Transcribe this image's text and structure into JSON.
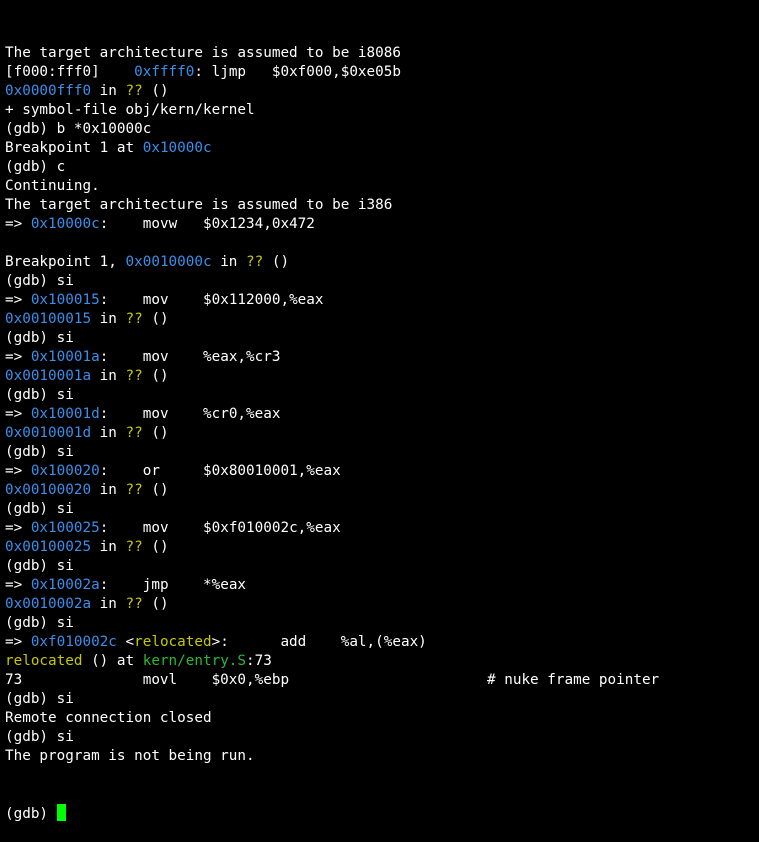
{
  "colors": {
    "background": "#000000",
    "text": "#ffffff",
    "address": "#3b8eea",
    "function": "#c8c800",
    "file": "#2fb82f",
    "cursor": "#00ff00"
  },
  "terminal": {
    "lines": [
      [
        {
          "t": "The target architecture is assumed to be i8086",
          "c": "text"
        }
      ],
      [
        {
          "t": "[f000:fff0]    ",
          "c": "text"
        },
        {
          "t": "0xffff0",
          "c": "addr"
        },
        {
          "t": ": ljmp   $0xf000,$0xe05b",
          "c": "text"
        }
      ],
      [
        {
          "t": "0x0000fff0",
          "c": "addr"
        },
        {
          "t": " in ",
          "c": "text"
        },
        {
          "t": "??",
          "c": "func"
        },
        {
          "t": " ()",
          "c": "text"
        }
      ],
      [
        {
          "t": "+ symbol-file obj/kern/kernel",
          "c": "text"
        }
      ],
      [
        {
          "t": "(gdb) b *0x10000c",
          "c": "text"
        }
      ],
      [
        {
          "t": "Breakpoint 1 at ",
          "c": "text"
        },
        {
          "t": "0x10000c",
          "c": "addr"
        }
      ],
      [
        {
          "t": "(gdb) c",
          "c": "text"
        }
      ],
      [
        {
          "t": "Continuing.",
          "c": "text"
        }
      ],
      [
        {
          "t": "The target architecture is assumed to be i386",
          "c": "text"
        }
      ],
      [
        {
          "t": "=> ",
          "c": "text"
        },
        {
          "t": "0x10000c",
          "c": "addr"
        },
        {
          "t": ":    movw   $0x1234,0x472",
          "c": "text"
        }
      ],
      [],
      [
        {
          "t": "Breakpoint 1, ",
          "c": "text"
        },
        {
          "t": "0x0010000c",
          "c": "addr"
        },
        {
          "t": " in ",
          "c": "text"
        },
        {
          "t": "??",
          "c": "func"
        },
        {
          "t": " ()",
          "c": "text"
        }
      ],
      [
        {
          "t": "(gdb) si",
          "c": "text"
        }
      ],
      [
        {
          "t": "=> ",
          "c": "text"
        },
        {
          "t": "0x100015",
          "c": "addr"
        },
        {
          "t": ":    mov    $0x112000,%eax",
          "c": "text"
        }
      ],
      [
        {
          "t": "0x00100015",
          "c": "addr"
        },
        {
          "t": " in ",
          "c": "text"
        },
        {
          "t": "??",
          "c": "func"
        },
        {
          "t": " ()",
          "c": "text"
        }
      ],
      [
        {
          "t": "(gdb) si",
          "c": "text"
        }
      ],
      [
        {
          "t": "=> ",
          "c": "text"
        },
        {
          "t": "0x10001a",
          "c": "addr"
        },
        {
          "t": ":    mov    %eax,%cr3",
          "c": "text"
        }
      ],
      [
        {
          "t": "0x0010001a",
          "c": "addr"
        },
        {
          "t": " in ",
          "c": "text"
        },
        {
          "t": "??",
          "c": "func"
        },
        {
          "t": " ()",
          "c": "text"
        }
      ],
      [
        {
          "t": "(gdb) si",
          "c": "text"
        }
      ],
      [
        {
          "t": "=> ",
          "c": "text"
        },
        {
          "t": "0x10001d",
          "c": "addr"
        },
        {
          "t": ":    mov    %cr0,%eax",
          "c": "text"
        }
      ],
      [
        {
          "t": "0x0010001d",
          "c": "addr"
        },
        {
          "t": " in ",
          "c": "text"
        },
        {
          "t": "??",
          "c": "func"
        },
        {
          "t": " ()",
          "c": "text"
        }
      ],
      [
        {
          "t": "(gdb) si",
          "c": "text"
        }
      ],
      [
        {
          "t": "=> ",
          "c": "text"
        },
        {
          "t": "0x100020",
          "c": "addr"
        },
        {
          "t": ":    or     $0x80010001,%eax",
          "c": "text"
        }
      ],
      [
        {
          "t": "0x00100020",
          "c": "addr"
        },
        {
          "t": " in ",
          "c": "text"
        },
        {
          "t": "??",
          "c": "func"
        },
        {
          "t": " ()",
          "c": "text"
        }
      ],
      [
        {
          "t": "(gdb) si",
          "c": "text"
        }
      ],
      [
        {
          "t": "=> ",
          "c": "text"
        },
        {
          "t": "0x100025",
          "c": "addr"
        },
        {
          "t": ":    mov    $0xf010002c,%eax",
          "c": "text"
        }
      ],
      [
        {
          "t": "0x00100025",
          "c": "addr"
        },
        {
          "t": " in ",
          "c": "text"
        },
        {
          "t": "??",
          "c": "func"
        },
        {
          "t": " ()",
          "c": "text"
        }
      ],
      [
        {
          "t": "(gdb) si",
          "c": "text"
        }
      ],
      [
        {
          "t": "=> ",
          "c": "text"
        },
        {
          "t": "0x10002a",
          "c": "addr"
        },
        {
          "t": ":    jmp    *%eax",
          "c": "text"
        }
      ],
      [
        {
          "t": "0x0010002a",
          "c": "addr"
        },
        {
          "t": " in ",
          "c": "text"
        },
        {
          "t": "??",
          "c": "func"
        },
        {
          "t": " ()",
          "c": "text"
        }
      ],
      [
        {
          "t": "(gdb) si",
          "c": "text"
        }
      ],
      [
        {
          "t": "=> ",
          "c": "text"
        },
        {
          "t": "0xf010002c",
          "c": "addr"
        },
        {
          "t": " <",
          "c": "text"
        },
        {
          "t": "relocated",
          "c": "func"
        },
        {
          "t": ">:      add    %al,(%eax)",
          "c": "text"
        }
      ],
      [
        {
          "t": "relocated",
          "c": "func"
        },
        {
          "t": " () at ",
          "c": "text"
        },
        {
          "t": "kern/entry.S",
          "c": "file"
        },
        {
          "t": ":73",
          "c": "text"
        }
      ],
      [
        {
          "t": "73              movl    $0x0,%ebp                       # nuke frame pointer",
          "c": "text"
        }
      ],
      [
        {
          "t": "(gdb) si",
          "c": "text"
        }
      ],
      [
        {
          "t": "Remote connection closed",
          "c": "text"
        }
      ],
      [
        {
          "t": "(gdb) si",
          "c": "text"
        }
      ],
      [
        {
          "t": "The program is not being run.",
          "c": "text"
        }
      ]
    ],
    "prompt": "(gdb) "
  }
}
